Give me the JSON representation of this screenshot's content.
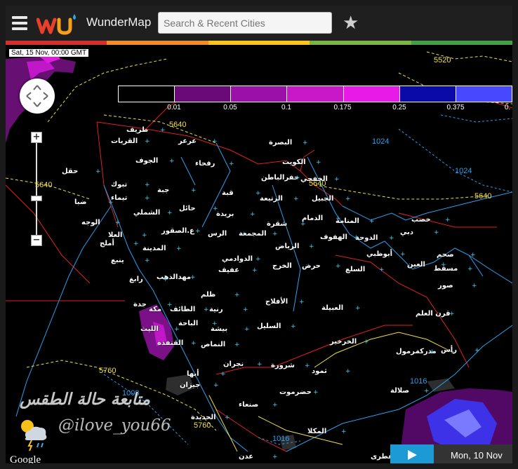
{
  "header": {
    "brand": "WunderMap",
    "search_placeholder": "Search & Recent Cities",
    "favorite_icon": "star-icon",
    "menu_icon": "hamburger-menu-icon",
    "logo": "wu-logo"
  },
  "color_stripe": [
    "#d32f2f",
    "#f28c28",
    "#f9c320",
    "#7cb342",
    "#43a047"
  ],
  "map": {
    "timestamp": "Sat, 15 Nov, 00:00 GMT",
    "legend": {
      "swatches": [
        "#000000",
        "#6a0a78",
        "#9a10a8",
        "#c818c8",
        "#e81ae8",
        "#0a0aa8",
        "#4848ff"
      ],
      "labels": [
        "0.01",
        "0.05",
        "0.1",
        "0.175",
        "0.25",
        "0.375",
        "0."
      ]
    },
    "contour_labels": {
      "upper_right": "5520",
      "upper_left": "5640",
      "left": "5640",
      "center": "5640",
      "right": "5640",
      "gulf_a": "1024",
      "gulf_b": "1024",
      "lower_left": "5760",
      "lower_mid": "5760",
      "sea_a": "1008",
      "sea_b": "1016",
      "sea_c": "1016"
    },
    "cities": [
      "البصرة",
      "الكويت",
      "الخفجي",
      "حفرالباطن",
      "رفحاء",
      "عرعر",
      "القريات",
      "طريف",
      "الجوف",
      "حقل",
      "تبوك",
      "ضبا",
      "تيماء",
      "جبة",
      "حائل",
      "قبة",
      "الرتيعة",
      "الجبيل",
      "الدمام",
      "المنامة",
      "الدوحة",
      "دبي",
      "خصب",
      "الوجه",
      "العلا",
      "الشملي",
      "ع.الصقور",
      "الرس",
      "بريدة",
      "المجمعة",
      "شقرة",
      "الهفوف",
      "أملج",
      "المدينة",
      "الرياض",
      "الخرج",
      "حرض",
      "أبوظبي",
      "العين",
      "صحم",
      "مسقط",
      "ينبع",
      "مهدالذهب",
      "عفيف",
      "الدوادمي",
      "السلع",
      "صور",
      "رابغ",
      "ظلم",
      "الأفلاج",
      "قرن العلم",
      "جدة",
      "مكة",
      "الطائف",
      "رنية",
      "العبيلة",
      "السليل",
      "الليث",
      "الباحة",
      "بيشة",
      "الخرخير",
      "مدركة",
      "رأس",
      "مرمول",
      "القنفذة",
      "النماص",
      "نجران",
      "شرورة",
      "ثمود",
      "أبها",
      "جيزان",
      "حضرموت",
      "صلالة",
      "صنعاء",
      "الحديدة",
      "المكلا",
      "عدن",
      "سقطرى"
    ]
  },
  "watermark": {
    "title": "متابعة حالة الطقس",
    "handle": "@ilove_you66",
    "icon": "storm-weather-icon"
  },
  "playback": {
    "date": "Mon, 10 Nov",
    "play_icon": "play-icon"
  },
  "attribution": "Google"
}
